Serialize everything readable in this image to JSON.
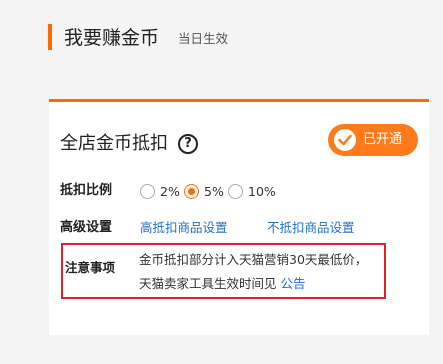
{
  "header": {
    "title": "我要赚金币",
    "subtitle": "当日生效"
  },
  "card": {
    "title": "全店金币抵扣",
    "help_symbol": "?",
    "status": {
      "label": "已开通",
      "color": "#ff7a1a"
    },
    "ratio": {
      "label": "抵扣比例",
      "options": [
        "2%",
        "5%",
        "10%"
      ],
      "selected": "5%"
    },
    "advanced": {
      "label": "高级设置",
      "links": [
        "高抵扣商品设置",
        "不抵扣商品设置"
      ]
    },
    "notice": {
      "label": "注意事项",
      "line1": "金币抵扣部分计入天猫营销30天最低价，",
      "line2": "天猫卖家工具生效时间见",
      "link": "公告"
    }
  },
  "colors": {
    "accent": "#ff6a00",
    "link": "#1f6fcf",
    "highlight_border": "#e0202a"
  }
}
